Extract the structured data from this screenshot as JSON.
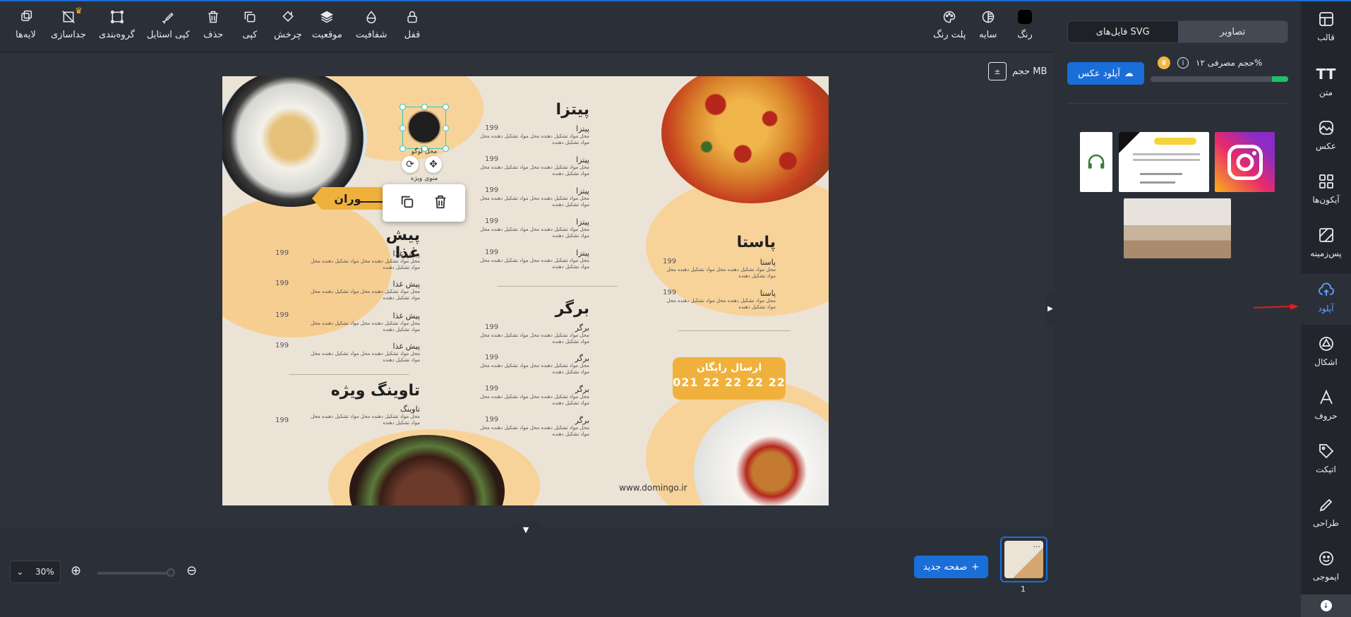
{
  "toolbar": {
    "left_tools": [
      {
        "label": "لایه‌ها",
        "icon": "layers-icon"
      },
      {
        "label": "جداسازی",
        "icon": "ungroup-icon"
      },
      {
        "label": "گروه‌بندی",
        "icon": "group-icon"
      },
      {
        "label": "کپی استایل",
        "icon": "brush-icon"
      },
      {
        "label": "حذف",
        "icon": "trash-icon"
      },
      {
        "label": "کپی",
        "icon": "copy-icon"
      },
      {
        "label": "چرخش",
        "icon": "rotate-icon"
      },
      {
        "label": "موقعیت",
        "icon": "position-icon"
      },
      {
        "label": "شفافیت",
        "icon": "opacity-icon"
      },
      {
        "label": "قفل",
        "icon": "lock-icon"
      }
    ],
    "right_tools": [
      {
        "label": "پلت رنگ",
        "icon": "palette-icon"
      },
      {
        "label": "سایه",
        "icon": "shadow-icon"
      },
      {
        "label": "رنگ",
        "icon": "color-swatch-icon",
        "color": "#000000"
      }
    ]
  },
  "canvas": {
    "size_label": "حجم MB"
  },
  "design": {
    "banner_text": "ـــــــوران",
    "logo_caption_1": "محل لوگو",
    "logo_caption_2": "منوی ویژه",
    "sections": {
      "appetizer": {
        "title": "پیش غذا",
        "item": "پیش غذا",
        "price": "199"
      },
      "topping": {
        "title": "تاوینگ ویژه",
        "item": "تاوینگ",
        "price": "199"
      },
      "pizza": {
        "title": "پیتزا",
        "item": "پیتزا",
        "price": "199"
      },
      "burger": {
        "title": "برگر",
        "item": "برگر",
        "price": "199"
      },
      "pasta": {
        "title": "پاستا",
        "item": "پاستا",
        "price": "199"
      }
    },
    "desc_text": "محل مواد تشکیل دهنده محل مواد تشکیل دهنده محل مواد تشکیل دهنده",
    "free_delivery": "ارسال رایگان",
    "phone": "021 22 22 22 22",
    "website": "www.domingo.ir"
  },
  "bottom": {
    "zoom_value": "30%",
    "new_page_label": "صفحه جدید",
    "page_number": "1"
  },
  "right_panel": {
    "tabs": [
      "تصاویر",
      "فایل‌های SVG"
    ],
    "active_tab": "تصاویر",
    "usage_label": "حجم مصرفی ۱۲%",
    "usage_percent": 12,
    "upload_label": "آپلود عکس",
    "uploaded_images": [
      "headset-logo",
      "business-card",
      "instagram-logo",
      "room-interior"
    ]
  },
  "sidebar": {
    "items": [
      {
        "label": "قالب",
        "icon": "template-icon"
      },
      {
        "label": "متن",
        "icon": "text-icon"
      },
      {
        "label": "عکس",
        "icon": "image-icon"
      },
      {
        "label": "آیکون‌ها",
        "icon": "icons-grid-icon"
      },
      {
        "label": "پس‌زمینه",
        "icon": "background-icon"
      },
      {
        "label": "آپلود",
        "icon": "upload-cloud-icon",
        "active": true
      },
      {
        "label": "اشکال",
        "icon": "shapes-icon"
      },
      {
        "label": "حروف",
        "icon": "letters-icon"
      },
      {
        "label": "اتیکت",
        "icon": "label-tag-icon"
      },
      {
        "label": "طراحی",
        "icon": "pen-icon"
      },
      {
        "label": "ایموجی",
        "icon": "emoji-icon"
      }
    ]
  },
  "colors": {
    "accent": "#1a6ed8",
    "active_sidebar": "#5ea2ff",
    "menu_orange": "#f0b13c",
    "usage_green": "#19c26b"
  }
}
